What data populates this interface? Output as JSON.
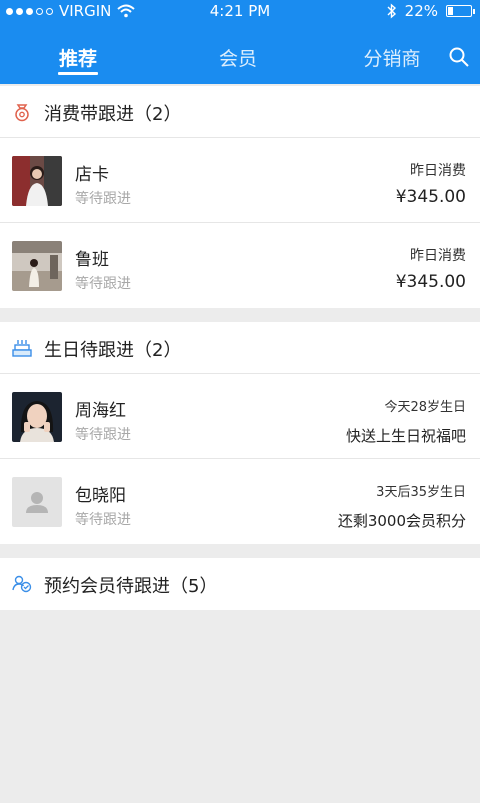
{
  "status_bar": {
    "carrier": "VIRGIN",
    "time": "4:21 PM",
    "battery": "22%",
    "battery_level": 0.22
  },
  "tabs": [
    {
      "label": "推荐",
      "active": true
    },
    {
      "label": "会员",
      "active": false
    },
    {
      "label": "分销商",
      "active": false
    }
  ],
  "colors": {
    "header_bg": "#1a8cf0",
    "section_icon_red": "#e0624d",
    "section_icon_blue": "#3b8fe8"
  },
  "sections": [
    {
      "icon": "money-bag-icon",
      "title": "消费带跟进（2）",
      "rows": [
        {
          "name": "店卡",
          "status": "等待跟进",
          "right_top": "昨日消费",
          "right_bottom": "¥345.00"
        },
        {
          "name": "鲁班",
          "status": "等待跟进",
          "right_top": "昨日消费",
          "right_bottom": "¥345.00"
        }
      ]
    },
    {
      "icon": "birthday-cake-icon",
      "title": "生日待跟进（2）",
      "rows": [
        {
          "name": "周海红",
          "status": "等待跟进",
          "right_top": "今天28岁生日",
          "right_bottom": "快送上生日祝福吧"
        },
        {
          "name": "包晓阳",
          "status": "等待跟进",
          "right_top": "3天后35岁生日",
          "right_bottom": "还剩3000会员积分"
        }
      ]
    },
    {
      "icon": "users-icon",
      "title": "预约会员待跟进（5）",
      "rows": []
    }
  ]
}
